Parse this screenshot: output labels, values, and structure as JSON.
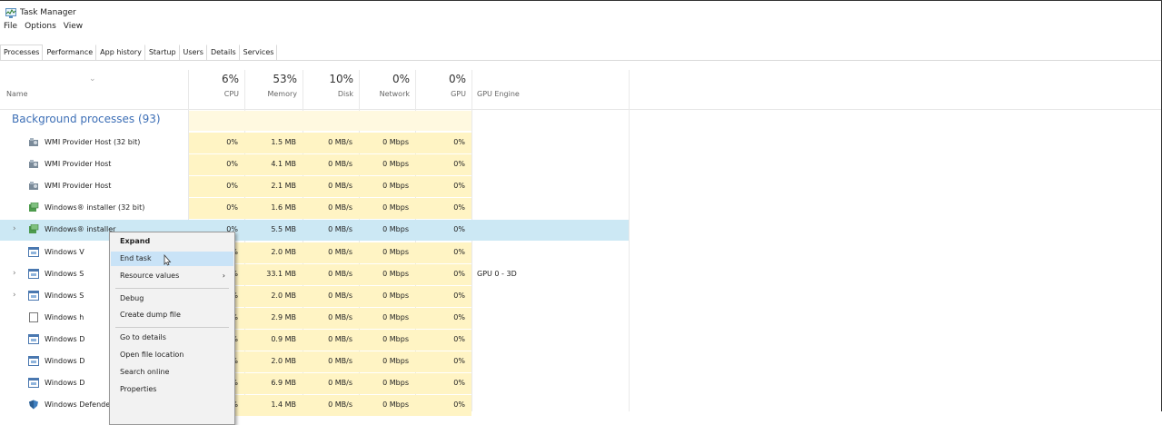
{
  "window": {
    "title": "Task Manager"
  },
  "menu": [
    "File",
    "Options",
    "View"
  ],
  "tabs": [
    "Processes",
    "Performance",
    "App history",
    "Startup",
    "Users",
    "Details",
    "Services"
  ],
  "columns": {
    "name": "Name",
    "cpu": {
      "pct": "6%",
      "label": "CPU"
    },
    "memory": {
      "pct": "53%",
      "label": "Memory"
    },
    "disk": {
      "pct": "10%",
      "label": "Disk"
    },
    "network": {
      "pct": "0%",
      "label": "Network"
    },
    "gpu": {
      "pct": "0%",
      "label": "GPU"
    },
    "gpu_engine": "GPU Engine"
  },
  "group": {
    "label": "Background processes (93)"
  },
  "rows": [
    {
      "name": "WMI Provider Host (32 bit)",
      "cpu": "0%",
      "memory": "1.5 MB",
      "disk": "0 MB/s",
      "network": "0 Mbps",
      "gpu": "0%",
      "gpu_engine": "",
      "icon": "wmi-icon"
    },
    {
      "name": "WMI Provider Host",
      "cpu": "0%",
      "memory": "4.1 MB",
      "disk": "0 MB/s",
      "network": "0 Mbps",
      "gpu": "0%",
      "gpu_engine": "",
      "icon": "wmi-icon"
    },
    {
      "name": "WMI Provider Host",
      "cpu": "0%",
      "memory": "2.1 MB",
      "disk": "0 MB/s",
      "network": "0 Mbps",
      "gpu": "0%",
      "gpu_engine": "",
      "icon": "wmi-icon"
    },
    {
      "name": "Windows® installer (32 bit)",
      "cpu": "0%",
      "memory": "1.6 MB",
      "disk": "0 MB/s",
      "network": "0 Mbps",
      "gpu": "0%",
      "gpu_engine": "",
      "icon": "installer-icon"
    },
    {
      "name": "Windows® installer",
      "cpu": "0%",
      "memory": "5.5 MB",
      "disk": "0 MB/s",
      "network": "0 Mbps",
      "gpu": "0%",
      "gpu_engine": "",
      "icon": "installer-icon"
    },
    {
      "name": "Windows V",
      "cpu": "%",
      "memory": "2.0 MB",
      "disk": "0 MB/s",
      "network": "0 Mbps",
      "gpu": "0%",
      "gpu_engine": "",
      "icon": "window-icon"
    },
    {
      "name": "Windows S",
      "cpu": "%",
      "memory": "33.1 MB",
      "disk": "0 MB/s",
      "network": "0 Mbps",
      "gpu": "0%",
      "gpu_engine": "GPU 0 - 3D",
      "icon": "window-icon"
    },
    {
      "name": "Windows S",
      "cpu": "%",
      "memory": "2.0 MB",
      "disk": "0 MB/s",
      "network": "0 Mbps",
      "gpu": "0%",
      "gpu_engine": "",
      "icon": "window-icon"
    },
    {
      "name": "Windows h",
      "cpu": "%",
      "memory": "2.9 MB",
      "disk": "0 MB/s",
      "network": "0 Mbps",
      "gpu": "0%",
      "gpu_engine": "",
      "icon": "document-icon"
    },
    {
      "name": "Windows D",
      "cpu": "%",
      "memory": "0.9 MB",
      "disk": "0 MB/s",
      "network": "0 Mbps",
      "gpu": "0%",
      "gpu_engine": "",
      "icon": "window-icon"
    },
    {
      "name": "Windows D",
      "cpu": "%",
      "memory": "2.0 MB",
      "disk": "0 MB/s",
      "network": "0 Mbps",
      "gpu": "0%",
      "gpu_engine": "",
      "icon": "window-icon"
    },
    {
      "name": "Windows D",
      "cpu": "%",
      "memory": "6.9 MB",
      "disk": "0 MB/s",
      "network": "0 Mbps",
      "gpu": "0%",
      "gpu_engine": "",
      "icon": "window-icon"
    },
    {
      "name": "Windows Defender notification ...",
      "cpu": "0%",
      "memory": "1.4 MB",
      "disk": "0 MB/s",
      "network": "0 Mbps",
      "gpu": "0%",
      "gpu_engine": "",
      "icon": "defender-icon"
    }
  ],
  "context_menu": {
    "items": [
      "Expand",
      "End task",
      "Resource values",
      "Debug",
      "Create dump file",
      "Go to details",
      "Open file location",
      "Search online",
      "Properties"
    ],
    "highlighted": "End task"
  },
  "colors": {
    "accent": "#3d6fb6",
    "heat": "#fff4c4",
    "selection": "#cce8f4",
    "menu_highlight": "#c9e3f7"
  }
}
